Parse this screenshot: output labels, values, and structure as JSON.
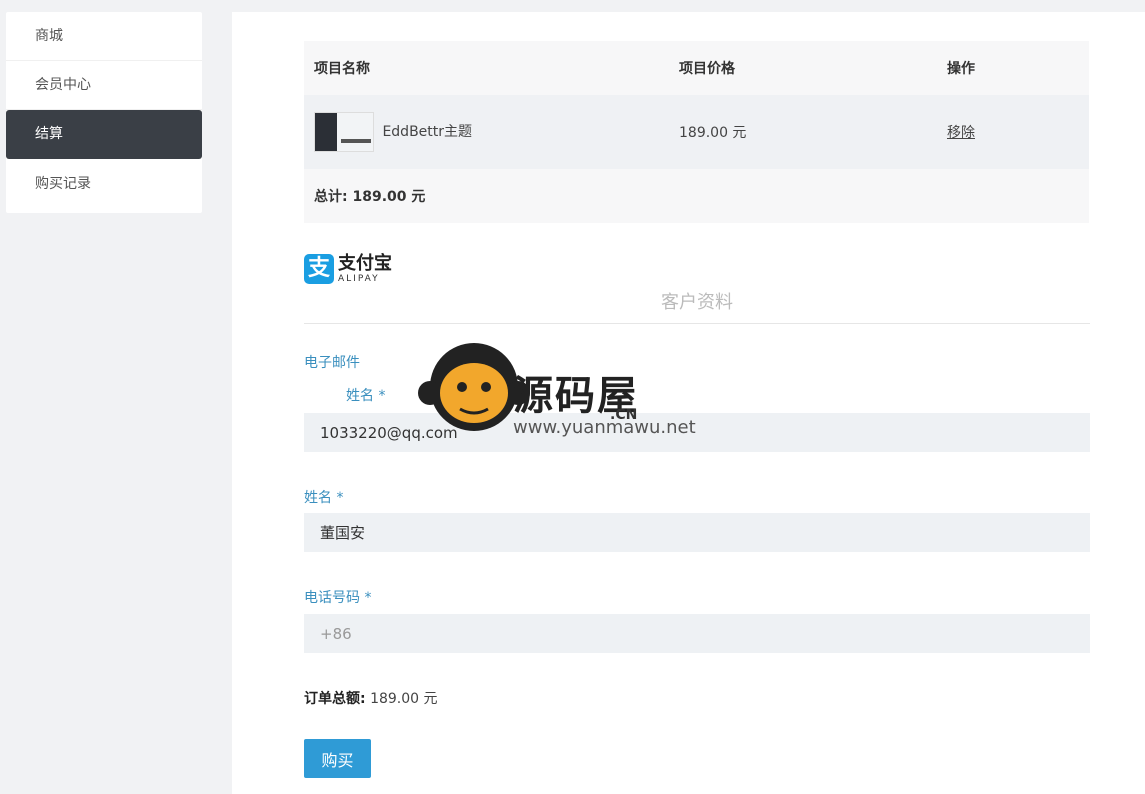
{
  "sidebar": {
    "items": [
      {
        "label": "商城"
      },
      {
        "label": "会员中心"
      },
      {
        "label": "结算"
      },
      {
        "label": "购买记录"
      }
    ],
    "active_index": 2
  },
  "cart": {
    "headers": [
      "项目名称",
      "项目价格",
      "操作"
    ],
    "item": {
      "name": "EddBettr主题",
      "price": "189.00 元",
      "action": "移除"
    },
    "total": "总计: 189.00 元"
  },
  "payment": {
    "alipay_cn": "支付宝",
    "alipay_en": "ALIPAY"
  },
  "customer": {
    "section_title": "客户资料",
    "email_label": "电子邮件",
    "email_value": "1033220@qq.com",
    "first_name_label": "姓名 *",
    "name_label": "姓名 *",
    "name_value": "董国安",
    "phone_label": "电话号码 *",
    "phone_placeholder": "+86"
  },
  "order": {
    "total_label": "订单总额:",
    "total_value": "189.00 元"
  },
  "buy_label": "购买",
  "watermark": {
    "title": "源码屋",
    "url": "www.yuanmawu.net",
    "suffix": ".CN"
  },
  "colors": {
    "accent": "#2f9bd6",
    "sidebar_active": "#3a3f46",
    "label_blue": "#3a8fbe",
    "alipay_blue": "#1a9ee2"
  }
}
